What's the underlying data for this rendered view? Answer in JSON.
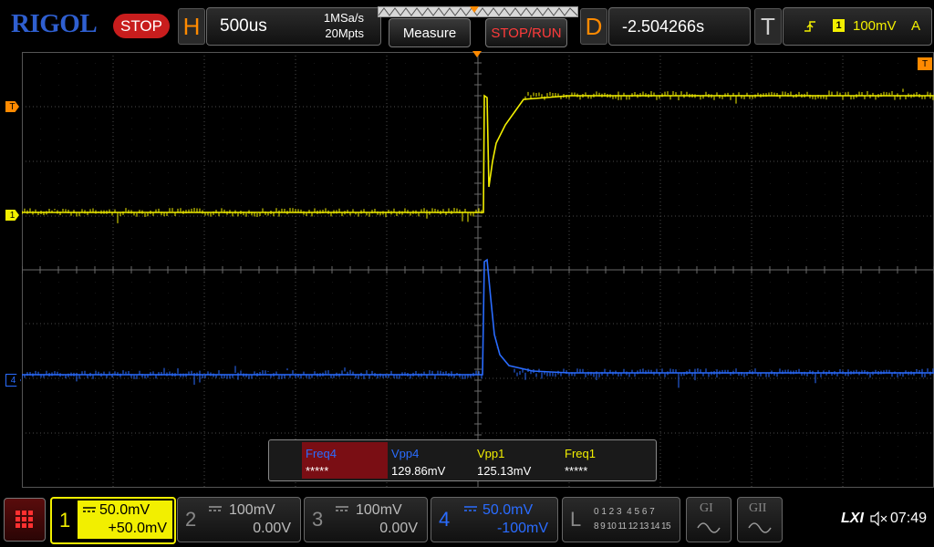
{
  "brand": "RIGOL",
  "run_state": "STOP",
  "horizontal": {
    "letter": "H",
    "timebase": "500us",
    "sample_rate": "1MSa/s",
    "mem_depth": "20Mpts"
  },
  "buttons": {
    "measure": "Measure",
    "stop_run": "STOP/RUN"
  },
  "delay": {
    "letter": "D",
    "value": "-2.504266s"
  },
  "trigger": {
    "letter": "T",
    "source": "1",
    "level": "100mV",
    "mode": "A"
  },
  "markers": {
    "trigger": "T",
    "ch1": "1",
    "ch4": "4"
  },
  "measurements": [
    {
      "name": "Freq4",
      "value": "*****",
      "color": "#2a6cff"
    },
    {
      "name": "Vpp4",
      "value": "129.86mV",
      "color": "#2a6cff"
    },
    {
      "name": "Vpp1",
      "value": "125.13mV",
      "color": "#f2ef00"
    },
    {
      "name": "Freq1",
      "value": "*****",
      "color": "#f2ef00"
    }
  ],
  "channels": [
    {
      "num": "1",
      "scale": "50.0mV",
      "offset": "+50.0mV"
    },
    {
      "num": "2",
      "scale": "100mV",
      "offset": "0.00V"
    },
    {
      "num": "3",
      "scale": "100mV",
      "offset": "0.00V"
    },
    {
      "num": "4",
      "scale": "50.0mV",
      "offset": "-100mV"
    }
  ],
  "logic": {
    "letter": "L",
    "row1": "0 1 2 3  4 5 6 7",
    "row2": "8 9 10 11 12 13 14 15"
  },
  "generators": [
    "GI",
    "GII"
  ],
  "status": {
    "lxi": "LXI",
    "time": "07:49"
  },
  "colors": {
    "ch1": "#f2ef00",
    "ch4": "#2a6cff",
    "accent": "#ff8a00",
    "stop": "#c81d1d"
  }
}
